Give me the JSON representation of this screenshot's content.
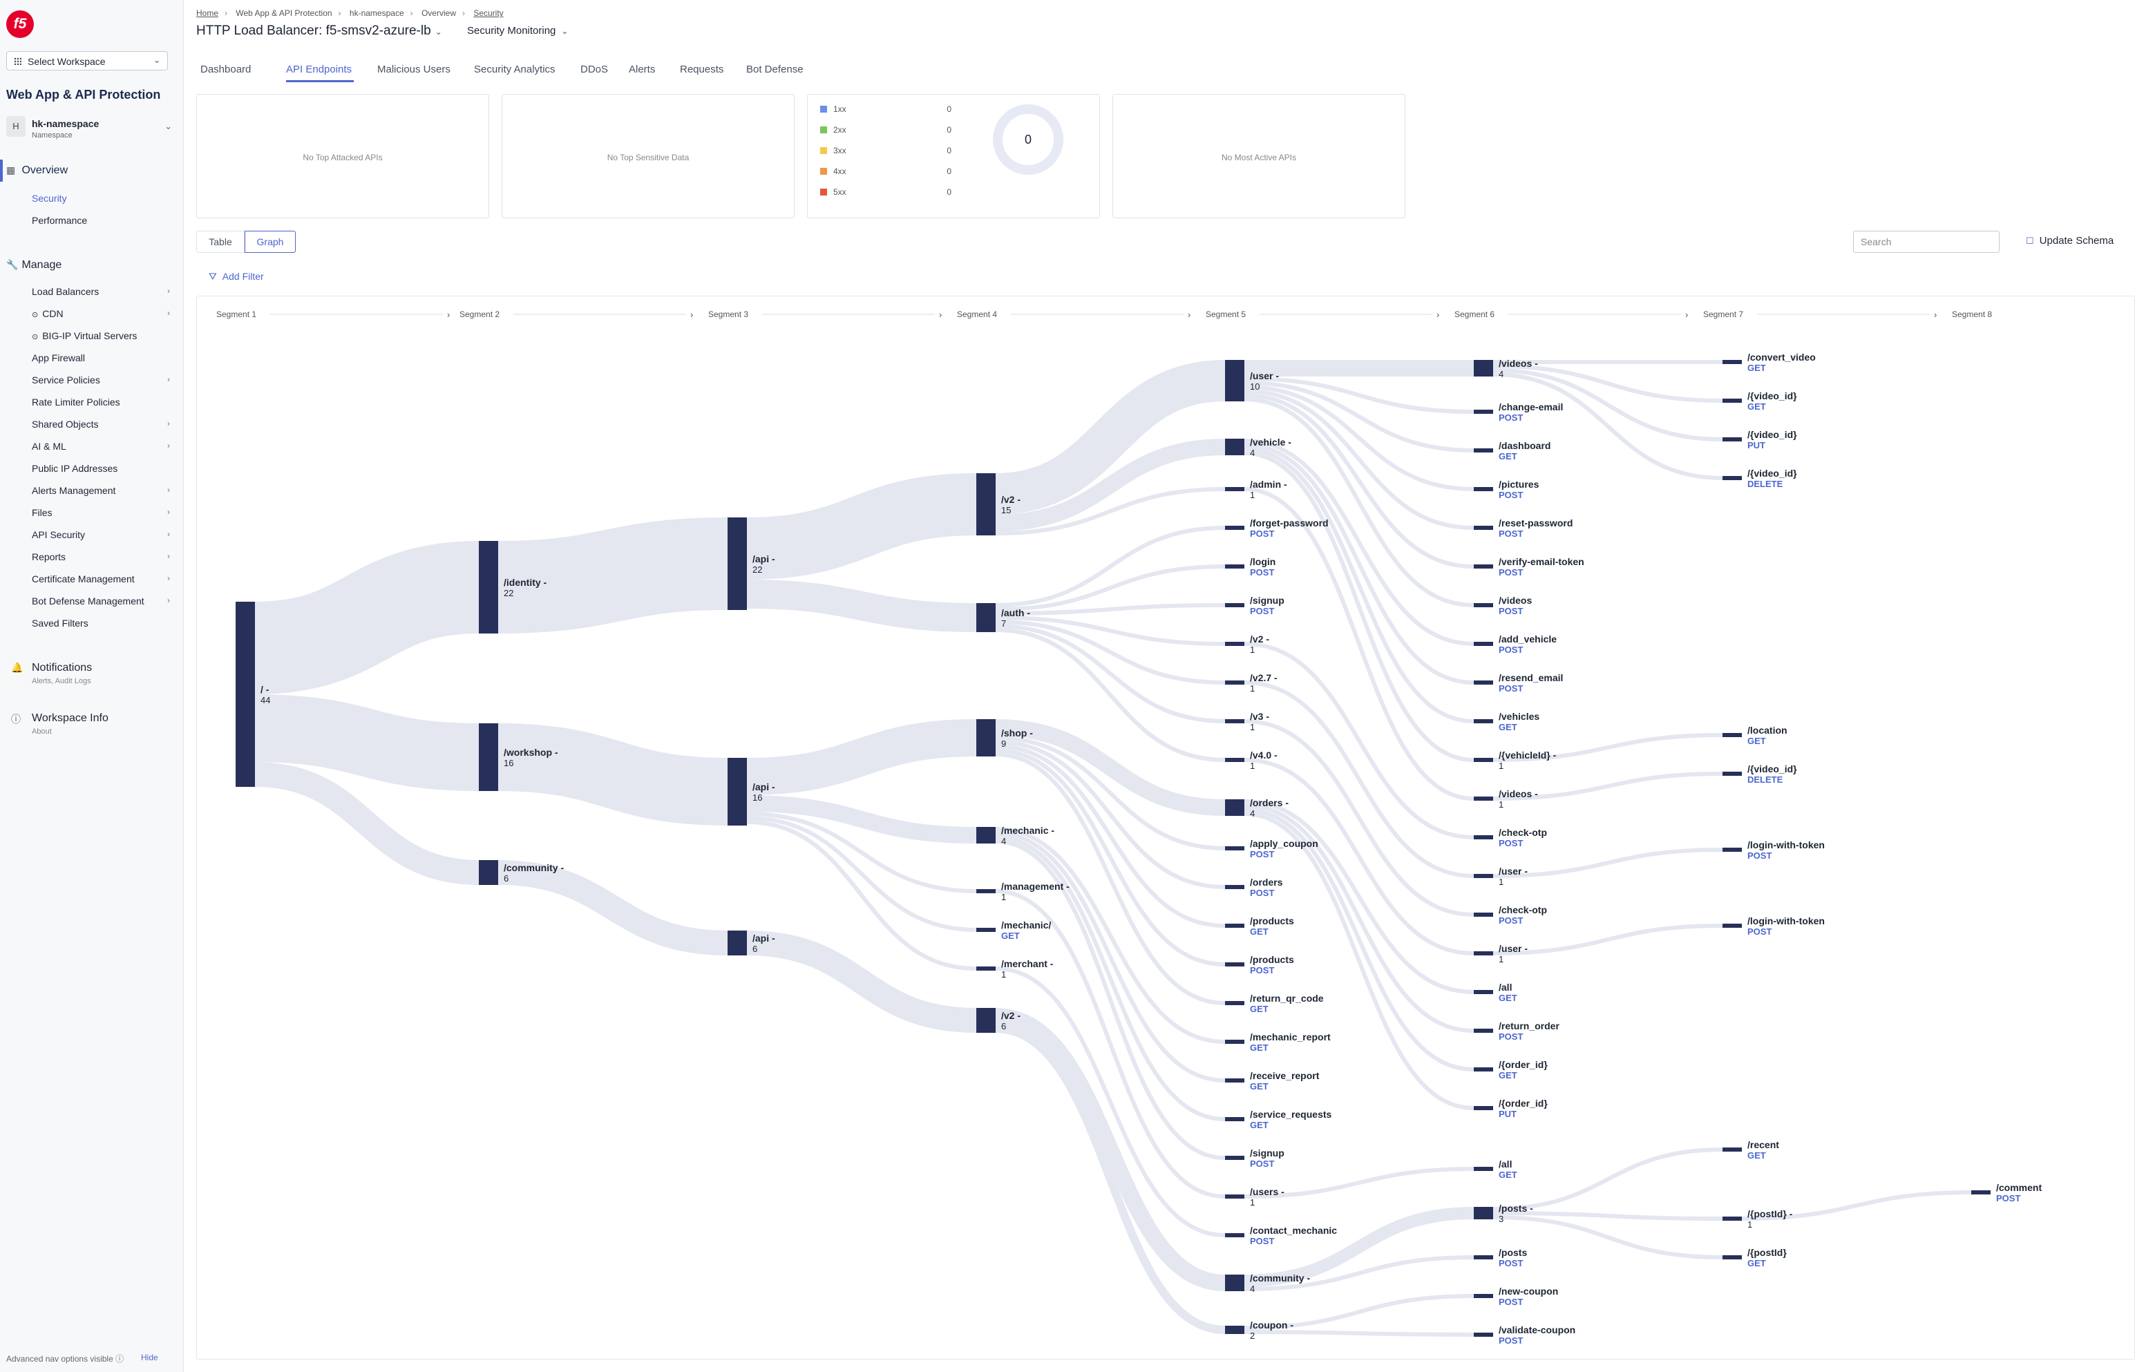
{
  "sidebar": {
    "logo": "f5",
    "workspace_select": "Select Workspace",
    "app_title": "Web App & API Protection",
    "namespace": {
      "avatar": "H",
      "name": "hk-namespace",
      "sub": "Namespace"
    },
    "overview": {
      "label": "Overview",
      "items": [
        "Security",
        "Performance"
      ]
    },
    "manage": {
      "label": "Manage",
      "items": [
        {
          "label": "Load Balancers",
          "arrow": "›"
        },
        {
          "label": "CDN",
          "arrow": "›"
        },
        {
          "label": "BIG-IP Virtual Servers",
          "arrow": ""
        },
        {
          "label": "App Firewall",
          "arrow": ""
        },
        {
          "label": "Service Policies",
          "arrow": "›"
        },
        {
          "label": "Rate Limiter Policies",
          "arrow": ""
        },
        {
          "label": "Shared Objects",
          "arrow": "›"
        },
        {
          "label": "AI & ML",
          "arrow": "›"
        },
        {
          "label": "Public IP Addresses",
          "arrow": ""
        },
        {
          "label": "Alerts Management",
          "arrow": "›"
        },
        {
          "label": "Files",
          "arrow": "›"
        },
        {
          "label": "API Security",
          "arrow": "›"
        },
        {
          "label": "Reports",
          "arrow": "›"
        },
        {
          "label": "Certificate Management",
          "arrow": "›"
        },
        {
          "label": "Bot Defense Management",
          "arrow": "›"
        },
        {
          "label": "Saved Filters",
          "arrow": ""
        }
      ]
    },
    "notifications": {
      "label": "Notifications",
      "sub": "Alerts, Audit Logs"
    },
    "workspace_info": {
      "label": "Workspace Info",
      "sub": "About"
    },
    "advanced": "Advanced nav options visible ⓘ",
    "hide": "Hide"
  },
  "header": {
    "breadcrumb": [
      "Home",
      "Web App & API Protection",
      "hk-namespace",
      "Overview",
      "Security"
    ],
    "title": "HTTP Load Balancer: f5-smsv2-azure-lb",
    "monitor": "Security Monitoring"
  },
  "tabs": [
    "Dashboard",
    "API Endpoints",
    "Malicious Users",
    "Security Analytics",
    "DDoS",
    "Alerts",
    "Requests",
    "Bot Defense"
  ],
  "cards": {
    "attacked": "No Top Attacked APIs",
    "sensitive": "No Top Sensitive Data",
    "active": "No Most Active APIs",
    "status_codes": [
      {
        "label": "1xx",
        "value": "0",
        "color": "#6b8fe8"
      },
      {
        "label": "2xx",
        "value": "0",
        "color": "#7ac55c"
      },
      {
        "label": "3xx",
        "value": "0",
        "color": "#f2c94c"
      },
      {
        "label": "4xx",
        "value": "0",
        "color": "#f0964a"
      },
      {
        "label": "5xx",
        "value": "0",
        "color": "#e4573d"
      }
    ],
    "donut_total": "0"
  },
  "view": {
    "table": "Table",
    "graph": "Graph"
  },
  "search": {
    "placeholder": "Search"
  },
  "update_schema": "Update Schema",
  "add_filter": "Add Filter",
  "colors": {
    "accent": "#4c66cf",
    "node": "#273058",
    "link": "#e4e6f0",
    "method": "#4c66cf"
  },
  "graph": {
    "segments": [
      "Segment 1",
      "Segment 2",
      "Segment 3",
      "Segment 4",
      "Segment 5",
      "Segment 6",
      "Segment 7",
      "Segment 8"
    ],
    "nodes": [
      {
        "id": "root",
        "seg": 1,
        "label": "/ -",
        "count": "44"
      },
      {
        "id": "identity",
        "seg": 2,
        "label": "/identity -",
        "count": "22"
      },
      {
        "id": "workshop",
        "seg": 2,
        "label": "/workshop -",
        "count": "16"
      },
      {
        "id": "community",
        "seg": 2,
        "label": "/community -",
        "count": "6"
      },
      {
        "id": "api1",
        "seg": 3,
        "label": "/api -",
        "count": "22"
      },
      {
        "id": "api2",
        "seg": 3,
        "label": "/api -",
        "count": "16"
      },
      {
        "id": "api3",
        "seg": 3,
        "label": "/api -",
        "count": "6"
      },
      {
        "id": "v2a",
        "seg": 4,
        "label": "/v2 -",
        "count": "15"
      },
      {
        "id": "auth",
        "seg": 4,
        "label": "/auth -",
        "count": "7"
      },
      {
        "id": "shop",
        "seg": 4,
        "label": "/shop -",
        "count": "9"
      },
      {
        "id": "mechanic",
        "seg": 4,
        "label": "/mechanic -",
        "count": "4"
      },
      {
        "id": "management",
        "seg": 4,
        "label": "/management -",
        "count": "1"
      },
      {
        "id": "mechanic2",
        "seg": 4,
        "label": "/mechanic/",
        "count": "GET"
      },
      {
        "id": "merchant",
        "seg": 4,
        "label": "/merchant -",
        "count": "1"
      },
      {
        "id": "v2b",
        "seg": 4,
        "label": "/v2 -",
        "count": "6"
      },
      {
        "id": "user",
        "seg": 5,
        "label": "/user -",
        "count": "10"
      },
      {
        "id": "vehicle",
        "seg": 5,
        "label": "/vehicle -",
        "count": "4"
      },
      {
        "id": "admin",
        "seg": 5,
        "label": "/admin -",
        "count": "1"
      },
      {
        "id": "forgetpw",
        "seg": 5,
        "label": "/forget-password",
        "count": "POST"
      },
      {
        "id": "login",
        "seg": 5,
        "label": "/login",
        "count": "POST"
      },
      {
        "id": "signup",
        "seg": 5,
        "label": "/signup",
        "count": "POST"
      },
      {
        "id": "v2c",
        "seg": 5,
        "label": "/v2 -",
        "count": "1"
      },
      {
        "id": "v27",
        "seg": 5,
        "label": "/v2.7 -",
        "count": "1"
      },
      {
        "id": "v3",
        "seg": 5,
        "label": "/v3 -",
        "count": "1"
      },
      {
        "id": "v40",
        "seg": 5,
        "label": "/v4.0 -",
        "count": "1"
      },
      {
        "id": "orders",
        "seg": 5,
        "label": "/orders -",
        "count": "4"
      },
      {
        "id": "applycoupon",
        "seg": 5,
        "label": "/apply_coupon",
        "count": "POST"
      },
      {
        "id": "orders2",
        "seg": 5,
        "label": "/orders",
        "count": "POST"
      },
      {
        "id": "products1",
        "seg": 5,
        "label": "/products",
        "count": "GET"
      },
      {
        "id": "products2",
        "seg": 5,
        "label": "/products",
        "count": "POST"
      },
      {
        "id": "returnqr",
        "seg": 5,
        "label": "/return_qr_code",
        "count": "GET"
      },
      {
        "id": "mechreport",
        "seg": 5,
        "label": "/mechanic_report",
        "count": "GET"
      },
      {
        "id": "recvreport",
        "seg": 5,
        "label": "/receive_report",
        "count": "GET"
      },
      {
        "id": "servicereq",
        "seg": 5,
        "label": "/service_requests",
        "count": "GET"
      },
      {
        "id": "signup2",
        "seg": 5,
        "label": "/signup",
        "count": "POST"
      },
      {
        "id": "users",
        "seg": 5,
        "label": "/users -",
        "count": "1"
      },
      {
        "id": "contactmech",
        "seg": 5,
        "label": "/contact_mechanic",
        "count": "POST"
      },
      {
        "id": "community2",
        "seg": 5,
        "label": "/community -",
        "count": "4"
      },
      {
        "id": "coupon",
        "seg": 5,
        "label": "/coupon -",
        "count": "2"
      },
      {
        "id": "videos",
        "seg": 6,
        "label": "/videos -",
        "count": "4"
      },
      {
        "id": "changeemail",
        "seg": 6,
        "label": "/change-email",
        "count": "POST"
      },
      {
        "id": "dashboard",
        "seg": 6,
        "label": "/dashboard",
        "count": "GET"
      },
      {
        "id": "pictures",
        "seg": 6,
        "label": "/pictures",
        "count": "POST"
      },
      {
        "id": "resetpw",
        "seg": 6,
        "label": "/reset-password",
        "count": "POST"
      },
      {
        "id": "verifyemail",
        "seg": 6,
        "label": "/verify-email-token",
        "count": "POST"
      },
      {
        "id": "videos2",
        "seg": 6,
        "label": "/videos",
        "count": "POST"
      },
      {
        "id": "addvehicle",
        "seg": 6,
        "label": "/add_vehicle",
        "count": "POST"
      },
      {
        "id": "resendemail",
        "seg": 6,
        "label": "/resend_email",
        "count": "POST"
      },
      {
        "id": "vehicles",
        "seg": 6,
        "label": "/vehicles",
        "count": "GET"
      },
      {
        "id": "vehicleid",
        "seg": 6,
        "label": "/{vehicleId} -",
        "count": "1"
      },
      {
        "id": "videos3",
        "seg": 6,
        "label": "/videos -",
        "count": "1"
      },
      {
        "id": "checkotp1",
        "seg": 6,
        "label": "/check-otp",
        "count": "POST"
      },
      {
        "id": "user2",
        "seg": 6,
        "label": "/user -",
        "count": "1"
      },
      {
        "id": "checkotp2",
        "seg": 6,
        "label": "/check-otp",
        "count": "POST"
      },
      {
        "id": "user3",
        "seg": 6,
        "label": "/user -",
        "count": "1"
      },
      {
        "id": "all1",
        "seg": 6,
        "label": "/all",
        "count": "GET"
      },
      {
        "id": "returnorder",
        "seg": 6,
        "label": "/return_order",
        "count": "POST"
      },
      {
        "id": "orderid1",
        "seg": 6,
        "label": "/{order_id}",
        "count": "GET"
      },
      {
        "id": "orderid2",
        "seg": 6,
        "label": "/{order_id}",
        "count": "PUT"
      },
      {
        "id": "all2",
        "seg": 6,
        "label": "/all",
        "count": "GET"
      },
      {
        "id": "posts",
        "seg": 6,
        "label": "/posts -",
        "count": "3"
      },
      {
        "id": "posts2",
        "seg": 6,
        "label": "/posts",
        "count": "POST"
      },
      {
        "id": "newcoupon",
        "seg": 6,
        "label": "/new-coupon",
        "count": "POST"
      },
      {
        "id": "validatecoupon",
        "seg": 6,
        "label": "/validate-coupon",
        "count": "POST"
      },
      {
        "id": "convertvideo",
        "seg": 7,
        "label": "/convert_video",
        "count": "GET"
      },
      {
        "id": "videoid1",
        "seg": 7,
        "label": "/{video_id}",
        "count": "GET"
      },
      {
        "id": "videoid2",
        "seg": 7,
        "label": "/{video_id}",
        "count": "PUT"
      },
      {
        "id": "videoid3",
        "seg": 7,
        "label": "/{video_id}",
        "count": "DELETE"
      },
      {
        "id": "location",
        "seg": 7,
        "label": "/location",
        "count": "GET"
      },
      {
        "id": "videoid4",
        "seg": 7,
        "label": "/{video_id}",
        "count": "DELETE"
      },
      {
        "id": "loginwt1",
        "seg": 7,
        "label": "/login-with-token",
        "count": "POST"
      },
      {
        "id": "loginwt2",
        "seg": 7,
        "label": "/login-with-token",
        "count": "POST"
      },
      {
        "id": "recent",
        "seg": 7,
        "label": "/recent",
        "count": "GET"
      },
      {
        "id": "postid1",
        "seg": 7,
        "label": "/{postId} -",
        "count": "1"
      },
      {
        "id": "postid2",
        "seg": 7,
        "label": "/{postId}",
        "count": "GET"
      },
      {
        "id": "comment",
        "seg": 8,
        "label": "/comment",
        "count": "POST"
      }
    ],
    "links": [
      [
        "root",
        "identity"
      ],
      [
        "root",
        "workshop"
      ],
      [
        "root",
        "community"
      ],
      [
        "identity",
        "api1"
      ],
      [
        "workshop",
        "api2"
      ],
      [
        "community",
        "api3"
      ],
      [
        "api1",
        "v2a"
      ],
      [
        "api1",
        "auth"
      ],
      [
        "api2",
        "shop"
      ],
      [
        "api2",
        "mechanic"
      ],
      [
        "api2",
        "management"
      ],
      [
        "api2",
        "mechanic2"
      ],
      [
        "api2",
        "merchant"
      ],
      [
        "api3",
        "v2b"
      ],
      [
        "v2a",
        "user"
      ],
      [
        "v2a",
        "vehicle"
      ],
      [
        "v2a",
        "admin"
      ],
      [
        "auth",
        "forgetpw"
      ],
      [
        "auth",
        "login"
      ],
      [
        "auth",
        "signup"
      ],
      [
        "auth",
        "v2c"
      ],
      [
        "auth",
        "v27"
      ],
      [
        "auth",
        "v3"
      ],
      [
        "auth",
        "v40"
      ],
      [
        "shop",
        "orders"
      ],
      [
        "shop",
        "applycoupon"
      ],
      [
        "shop",
        "orders2"
      ],
      [
        "shop",
        "products1"
      ],
      [
        "shop",
        "products2"
      ],
      [
        "shop",
        "returnqr"
      ],
      [
        "mechanic",
        "mechreport"
      ],
      [
        "mechanic",
        "recvreport"
      ],
      [
        "mechanic",
        "servicereq"
      ],
      [
        "mechanic",
        "signup2"
      ],
      [
        "management",
        "users"
      ],
      [
        "merchant",
        "contactmech"
      ],
      [
        "v2b",
        "community2"
      ],
      [
        "v2b",
        "coupon"
      ],
      [
        "user",
        "videos"
      ],
      [
        "user",
        "changeemail"
      ],
      [
        "user",
        "dashboard"
      ],
      [
        "user",
        "pictures"
      ],
      [
        "user",
        "resetpw"
      ],
      [
        "user",
        "verifyemail"
      ],
      [
        "user",
        "videos2"
      ],
      [
        "vehicle",
        "addvehicle"
      ],
      [
        "vehicle",
        "resendemail"
      ],
      [
        "vehicle",
        "vehicles"
      ],
      [
        "vehicle",
        "vehicleid"
      ],
      [
        "admin",
        "videos3"
      ],
      [
        "v2c",
        "checkotp1"
      ],
      [
        "v27",
        "user2"
      ],
      [
        "v3",
        "checkotp2"
      ],
      [
        "v40",
        "user3"
      ],
      [
        "orders",
        "all1"
      ],
      [
        "orders",
        "returnorder"
      ],
      [
        "orders",
        "orderid1"
      ],
      [
        "orders",
        "orderid2"
      ],
      [
        "users",
        "all2"
      ],
      [
        "community2",
        "posts"
      ],
      [
        "community2",
        "posts2"
      ],
      [
        "coupon",
        "newcoupon"
      ],
      [
        "coupon",
        "validatecoupon"
      ],
      [
        "videos",
        "convertvideo"
      ],
      [
        "videos",
        "videoid1"
      ],
      [
        "videos",
        "videoid2"
      ],
      [
        "videos",
        "videoid3"
      ],
      [
        "vehicleid",
        "location"
      ],
      [
        "videos3",
        "videoid4"
      ],
      [
        "user2",
        "loginwt1"
      ],
      [
        "user3",
        "loginwt2"
      ],
      [
        "posts",
        "recent"
      ],
      [
        "posts",
        "postid1"
      ],
      [
        "posts",
        "postid2"
      ],
      [
        "postid1",
        "comment"
      ]
    ]
  }
}
